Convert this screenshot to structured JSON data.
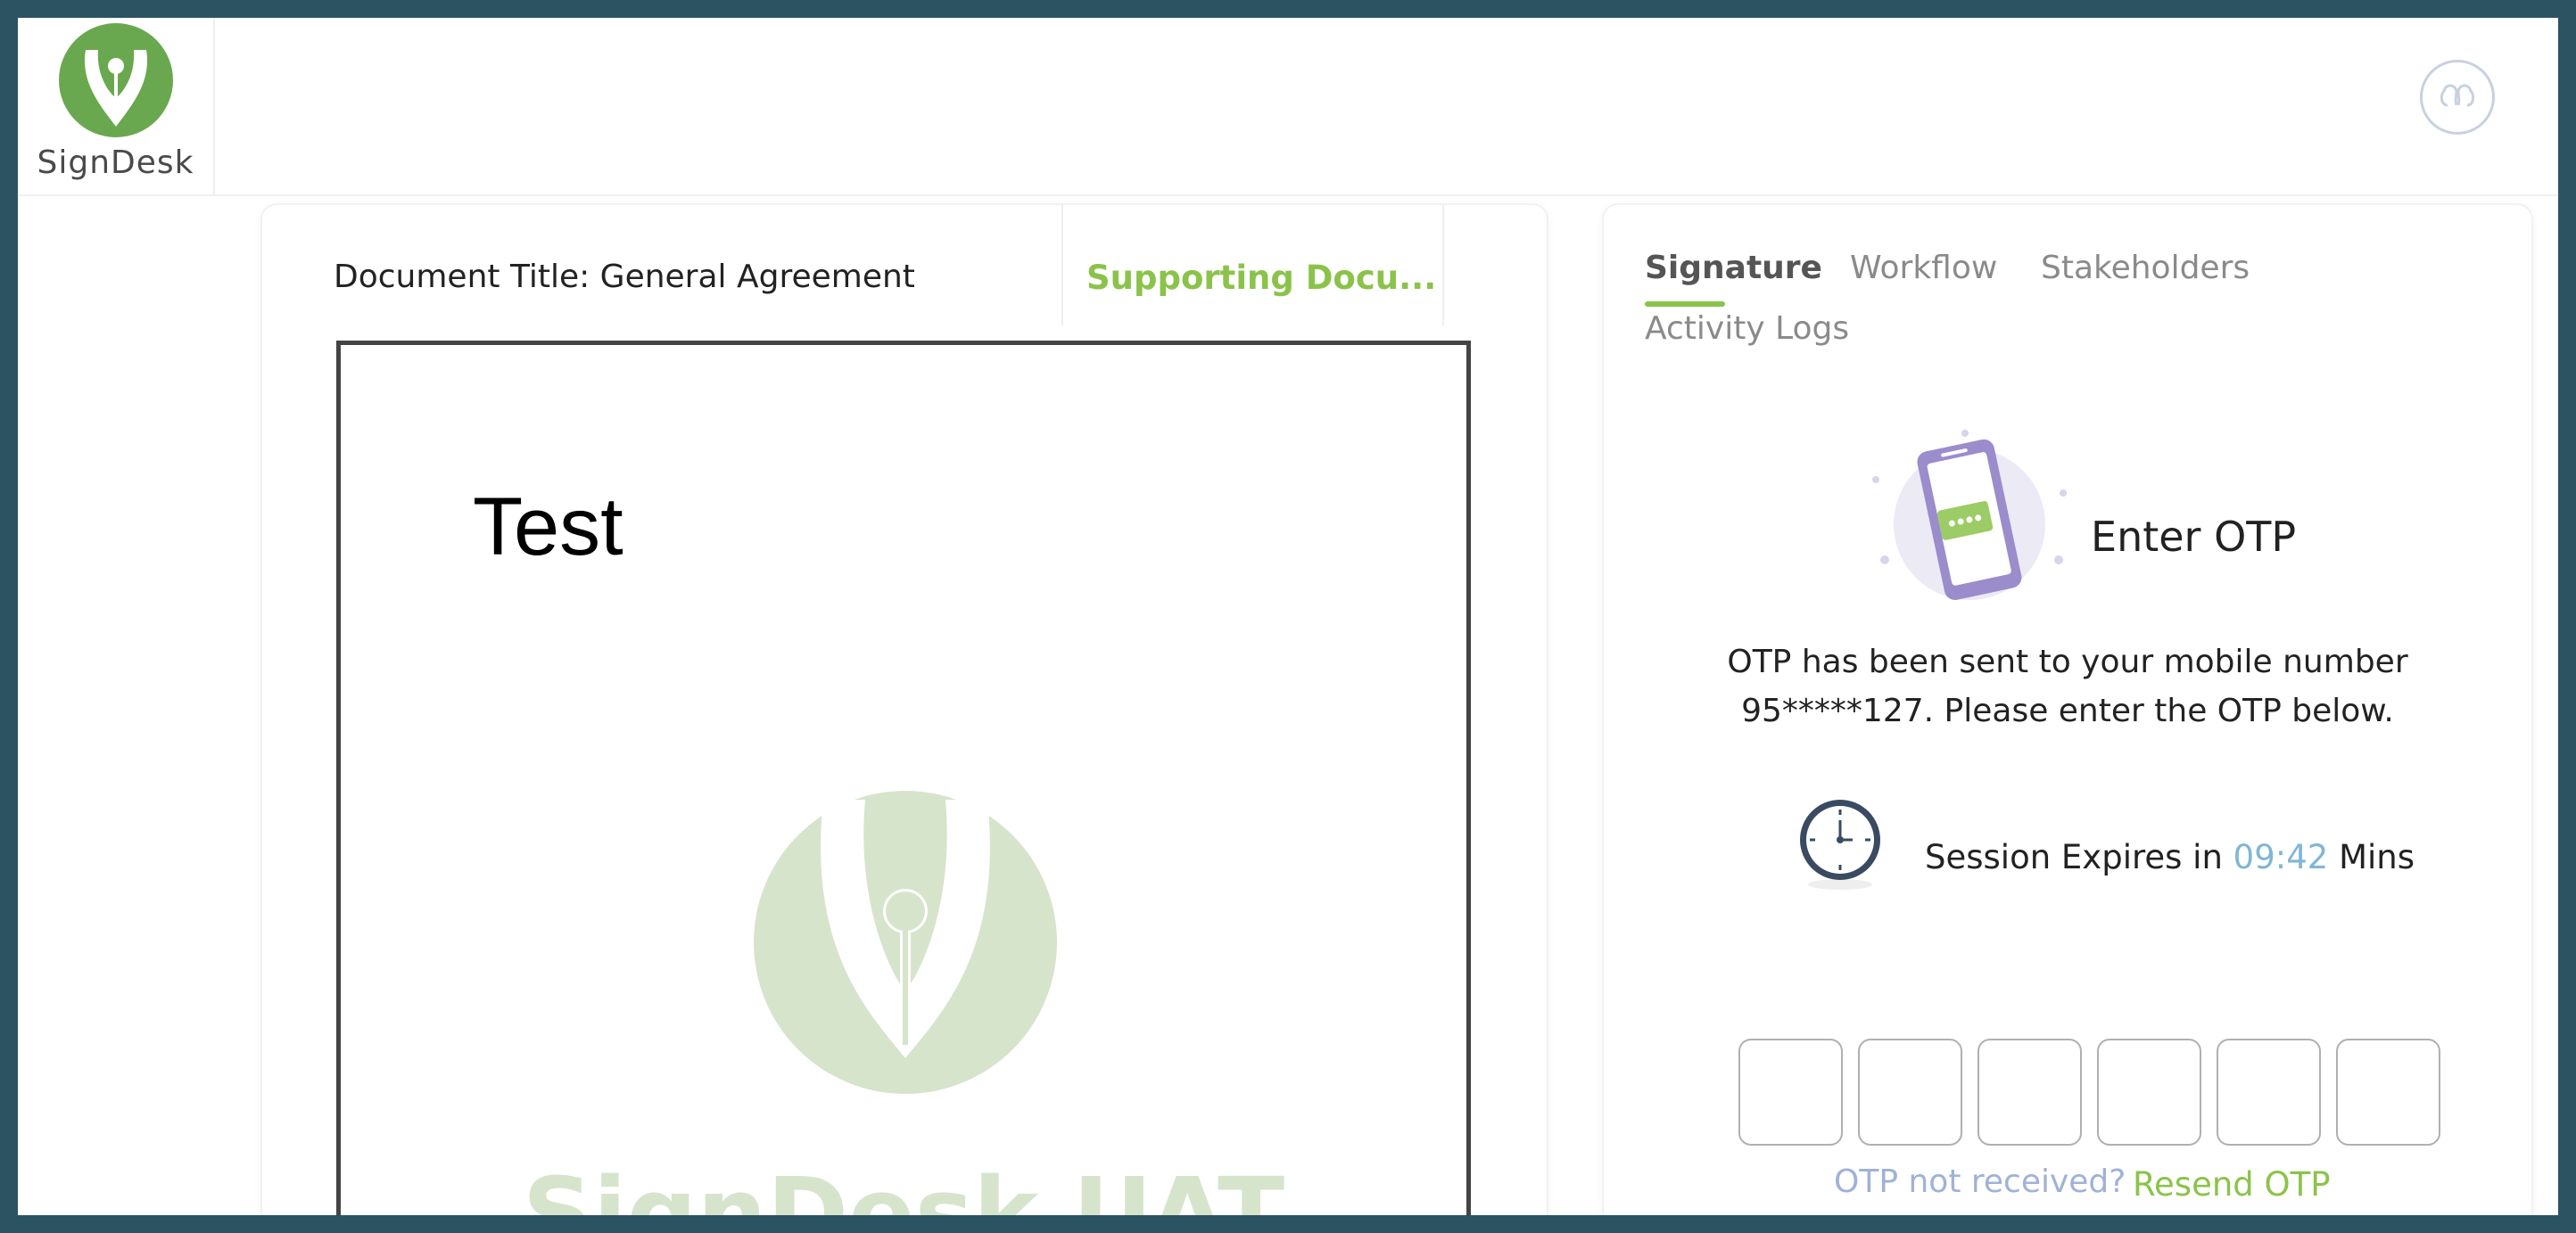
{
  "app": {
    "logo_text": "SignDesk"
  },
  "document": {
    "title": "Document Title: General Agreement",
    "supporting_tab": "Supporting Docu...",
    "page_text": "Test",
    "watermark_text": "SignDesk UAT"
  },
  "panel": {
    "tabs": [
      {
        "label": "Signature",
        "active": true
      },
      {
        "label": "Workflow",
        "active": false
      },
      {
        "label": "Stakeholders",
        "active": false
      },
      {
        "label": "Activity Logs",
        "active": false
      }
    ],
    "otp_heading": "Enter OTP",
    "otp_message_line1": "OTP has been sent to your mobile number",
    "otp_message_line2": "95*****127. Please enter the OTP below.",
    "session_prefix": "Session Expires in",
    "session_timer": "09:42",
    "session_suffix": "Mins",
    "otp_fields": [
      "",
      "",
      "",
      "",
      "",
      ""
    ],
    "not_received": "OTP not received?",
    "resend": "Resend OTP"
  },
  "colors": {
    "frame": "#2c5362",
    "brand_green": "#8bc34a",
    "logo_green": "#6aa84f",
    "timer_blue": "#7fb6d6",
    "link_muted": "#9fb2d8"
  },
  "icons": {
    "logo": "pen-nib-logo-icon",
    "avatar": "user-avatar-icon",
    "otp": "phone-message-icon",
    "clock": "clock-icon",
    "watermark": "pen-nib-watermark-icon"
  }
}
